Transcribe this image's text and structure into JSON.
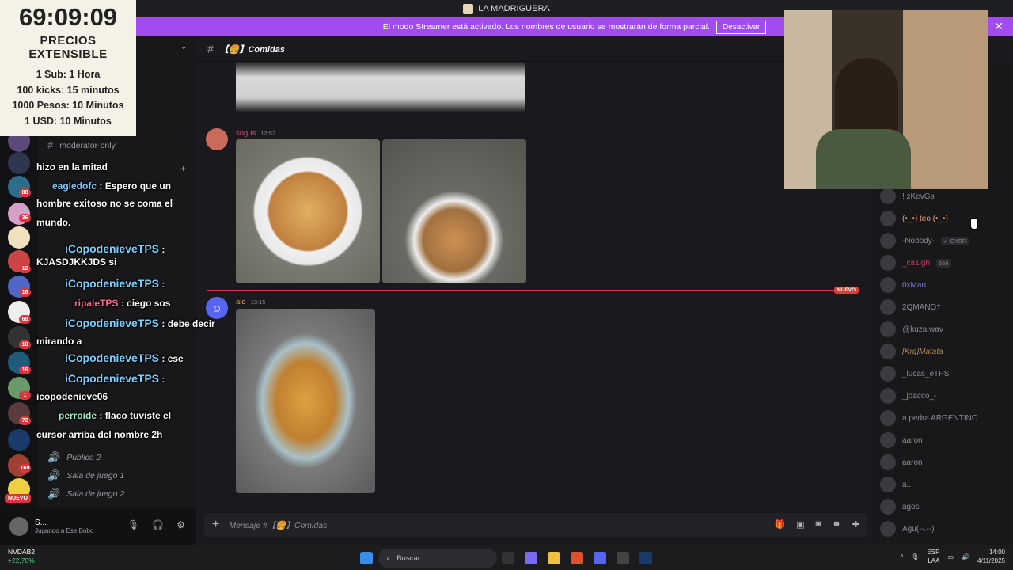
{
  "window": {
    "title": "LA MADRIGUERA"
  },
  "streamer_bar": {
    "message": "El modo Streamer está activado. Los nombres de usuario se mostrarán de forma parcial.",
    "button": "Desactivar"
  },
  "timer_overlay": {
    "time": "69:09:09",
    "line1": "PRECIOS",
    "line2": "EXTENSIBLE",
    "prices": [
      "1 Sub: 1 Hora",
      "100 kicks: 15 minutos",
      "1000 Pesos: 10 Minutos",
      "1 USD: 10 Minutos"
    ]
  },
  "channel_header": {
    "name": "【🍔】Comidas"
  },
  "channels": {
    "items": [
      {
        "label": "moderator-only",
        "icon": "#"
      },
      {
        "label": "Publico 2",
        "icon": "🔊"
      },
      {
        "label": "Sala de juego 1",
        "icon": "🔊"
      },
      {
        "label": "Sala de juego 2",
        "icon": "🔊"
      }
    ]
  },
  "server_badges": [
    "88",
    "36",
    "12",
    "16",
    "68",
    "10",
    "16",
    "1",
    "72",
    "169"
  ],
  "messages": [
    {
      "author": "sugus",
      "time": "12:52",
      "color": "#e0457b"
    },
    {
      "author": "ale",
      "time": "13:15",
      "color": "#e8a84c"
    }
  ],
  "new_divider": "NUEVO",
  "members": [
    {
      "name": "! zKevGs",
      "tag": ""
    },
    {
      "name": "(•_•) teo (•_•)",
      "tag": ""
    },
    {
      "name": "-Nobody-",
      "tag": "✓ CYBR"
    },
    {
      "name": "_ca1igh",
      "tag": "666"
    },
    {
      "name": "0xMau",
      "tag": ""
    },
    {
      "name": "2QMANO†",
      "tag": ""
    },
    {
      "name": "@kuza.wav",
      "tag": ""
    },
    {
      "name": "[Krg]Matata",
      "tag": ""
    },
    {
      "name": "_lucas_eTPS",
      "tag": ""
    },
    {
      "name": "_joacco_-",
      "tag": ""
    },
    {
      "name": "a pedra ARGENTINO",
      "tag": ""
    },
    {
      "name": "aaron",
      "tag": ""
    },
    {
      "name": "aaron",
      "tag": ""
    },
    {
      "name": "a...",
      "tag": ""
    },
    {
      "name": "agos",
      "tag": ""
    },
    {
      "name": "Agu(--.--)",
      "tag": ""
    }
  ],
  "user_panel": {
    "name": "S...",
    "status": "Jugando a Ese Bobo"
  },
  "composer": {
    "placeholder": "Mensaje #【🍔】Comidas"
  },
  "taskbar": {
    "stock_name": "NVDAB2",
    "stock_change": "+22,70%",
    "search": "Buscar",
    "lang1": "ESP",
    "lang2": "LAA",
    "time": "14:00",
    "date": "4/11/2025"
  },
  "nuevo_pill": "NUEVO",
  "chat_overlay": [
    {
      "user": "",
      "text": "hizo en la mitad"
    },
    {
      "user": "eagledofc",
      "text": ": Espero que un"
    },
    {
      "user": "",
      "text": "hombre exitoso no se coma el"
    },
    {
      "user": "",
      "text": "mundo."
    },
    {
      "user": "iCopodenieveTPS",
      "text": ":"
    },
    {
      "user": "",
      "text": "KJASDJKKJDS si"
    },
    {
      "user": "iCopodenieveTPS",
      "text": ":"
    },
    {
      "user": "ripaleTPS",
      "text": ": ciego sos"
    },
    {
      "user": "iCopodenieveTPS",
      "text": ": debe decir"
    },
    {
      "user": "",
      "text": "mirando a"
    },
    {
      "user": "iCopodenieveTPS",
      "text": ": ese"
    },
    {
      "user": "iCopodenieveTPS",
      "text": ":"
    },
    {
      "user": "",
      "text": "icopodenieve06"
    },
    {
      "user": "perroide",
      "text": ": flaco tuviste el"
    },
    {
      "user": "",
      "text": "cursor arriba del nombre 2h"
    }
  ]
}
